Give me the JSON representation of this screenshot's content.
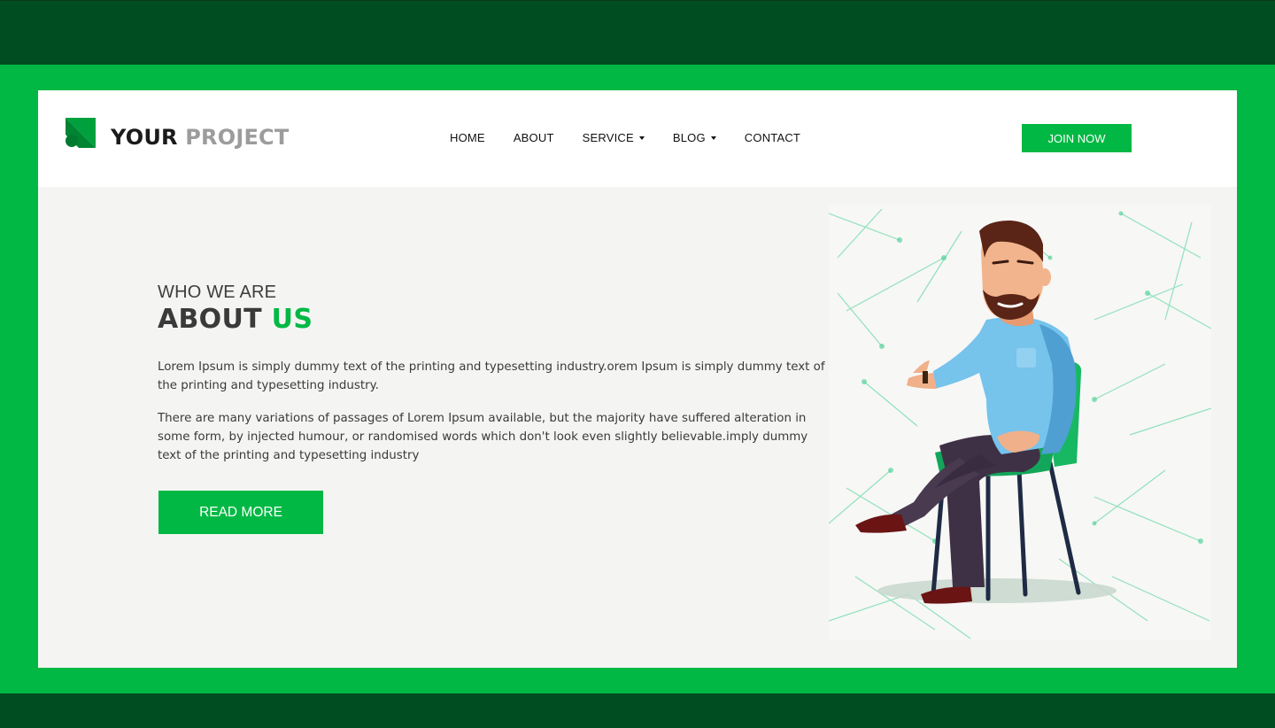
{
  "brand": {
    "word1": "YOUR",
    "word2": "PROJECT"
  },
  "nav": {
    "items": [
      {
        "label": "HOME",
        "dropdown": false
      },
      {
        "label": "ABOUT",
        "dropdown": false
      },
      {
        "label": "SERVICE",
        "dropdown": true
      },
      {
        "label": "BLOG",
        "dropdown": true
      },
      {
        "label": "CONTACT",
        "dropdown": false
      }
    ],
    "cta_label": "JOIN NOW"
  },
  "about": {
    "subtitle": "WHO WE ARE",
    "title_part1": "ABOUT",
    "title_part2": "US",
    "paragraph1": "Lorem Ipsum is simply dummy text of the printing and typesetting industry.orem Ipsum is simply dummy text of the printing and typesetting industry.",
    "paragraph2": "There are many variations of passages of Lorem Ipsum available, but the majority have suffered alteration in some form, by injected humour, or randomised words which don't look even slightly believable.imply dummy text of the printing and typesetting industry",
    "button_label": "READ MORE"
  },
  "colors": {
    "accent": "#00b843",
    "dark_band": "#004d22",
    "text_dark": "#3a3a3a",
    "logo_gray": "#9c9c9c",
    "content_bg": "#f4f5f2"
  },
  "illustration": {
    "icon": "man-seated-on-chair-gesturing-illustration"
  }
}
